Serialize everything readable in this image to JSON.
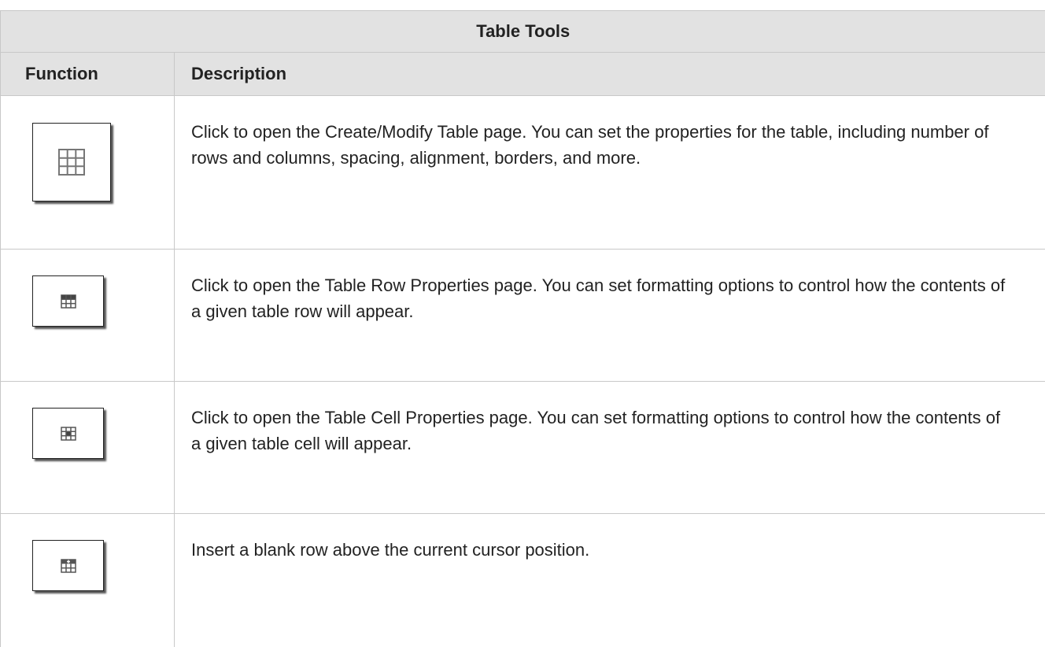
{
  "table": {
    "title": "Table Tools",
    "headers": {
      "function": "Function",
      "description": "Description"
    },
    "rows": [
      {
        "icon": "table-grid-icon",
        "description": "Click to open the Create/Modify Table page. You can set the properties for the table, including number of rows and columns, spacing, alignment, borders, and more."
      },
      {
        "icon": "table-row-properties-icon",
        "description": "Click to open the Table Row Properties page. You can set formatting options to control how the contents of a given table row will appear."
      },
      {
        "icon": "table-cell-properties-icon",
        "description": "Click to open the Table Cell Properties page. You can set formatting options to control how the contents of a given table cell will appear."
      },
      {
        "icon": "insert-row-above-icon",
        "description": "Insert a blank row above the current cursor position."
      }
    ]
  }
}
